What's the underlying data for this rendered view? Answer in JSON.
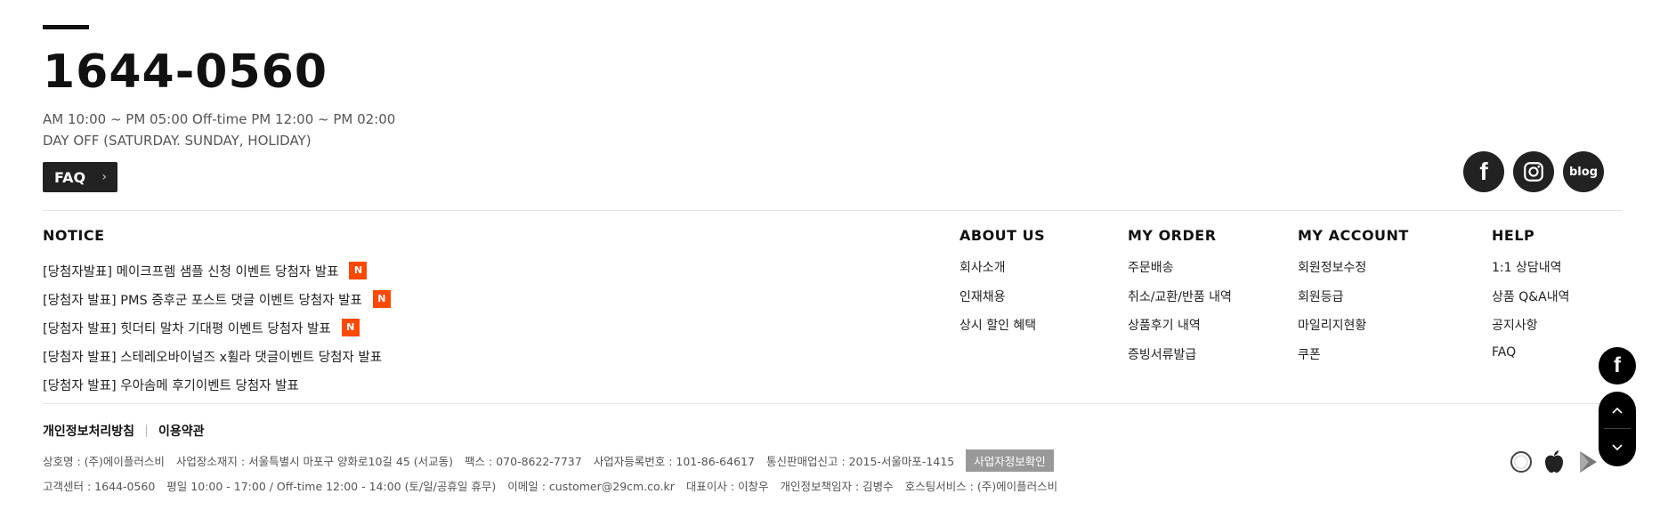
{
  "contact": {
    "phone": "1644-0560",
    "hours_line1": "AM 10:00 ~ PM 05:00  Off-time PM 12:00 ~ PM 02:00",
    "hours_line2": "DAY OFF (SATURDAY. SUNDAY, HOLIDAY)",
    "faq_label": "FAQ"
  },
  "social": {
    "facebook": "f",
    "blog": "blog"
  },
  "notice": {
    "title": "NOTICE",
    "badge": "N",
    "items": [
      {
        "text": "[당첨자발표] 메이크프렘 샘플 신청 이벤트 당첨자 발표",
        "new": true
      },
      {
        "text": "[당첨자 발표] PMS 증후군 포스트 댓글 이벤트 당첨자 발표",
        "new": true
      },
      {
        "text": "[당첨자 발표] 힛더티 말차 기대평 이벤트 당첨자 발표",
        "new": true
      },
      {
        "text": "[당첨자 발표] 스테레오바이널즈 x휠라 댓글이벤트 당첨자 발표",
        "new": false
      },
      {
        "text": "[당첨자 발표] 우아솜메 후기이벤트 당첨자 발표",
        "new": false
      }
    ]
  },
  "menus": {
    "about": {
      "title": "ABOUT US",
      "items": [
        "회사소개",
        "인재채용",
        "상시 할인 혜택"
      ]
    },
    "order": {
      "title": "MY ORDER",
      "items": [
        "주문배송",
        "취소/교환/반품 내역",
        "상품후기 내역",
        "증빙서류발급"
      ]
    },
    "account": {
      "title": "MY ACCOUNT",
      "items": [
        "회원정보수정",
        "회원등급",
        "마일리지현황",
        "쿠폰"
      ]
    },
    "help": {
      "title": "HELP",
      "items": [
        "1:1 상담내역",
        "상품 Q&A내역",
        "공지사항",
        "FAQ"
      ]
    }
  },
  "policy": {
    "privacy": "개인정보처리방침",
    "terms": "이용약관"
  },
  "company": {
    "line1": [
      "상호명 : (주)에이플러스비",
      "사업장소재지 : 서울특별시 마포구 양화로10길 45 (서교동)",
      "팩스 : 070-8622-7737",
      "사업자등록번호 : 101-86-64617",
      "통신판매업신고 : 2015-서울마포-1415"
    ],
    "biz_button": "사업자정보확인",
    "line2": [
      "고객센터 : 1644-0560",
      "평일 10:00 - 17:00 / Off-time 12:00 - 14:00 (토/일/공휴일 휴무)",
      "이메일 : customer@29cm.co.kr",
      "대표이사 : 이창우",
      "개인정보책임자 : 김병수",
      "호스팅서비스 : (주)에이플러스비"
    ]
  },
  "side": {
    "facebook": "f"
  }
}
